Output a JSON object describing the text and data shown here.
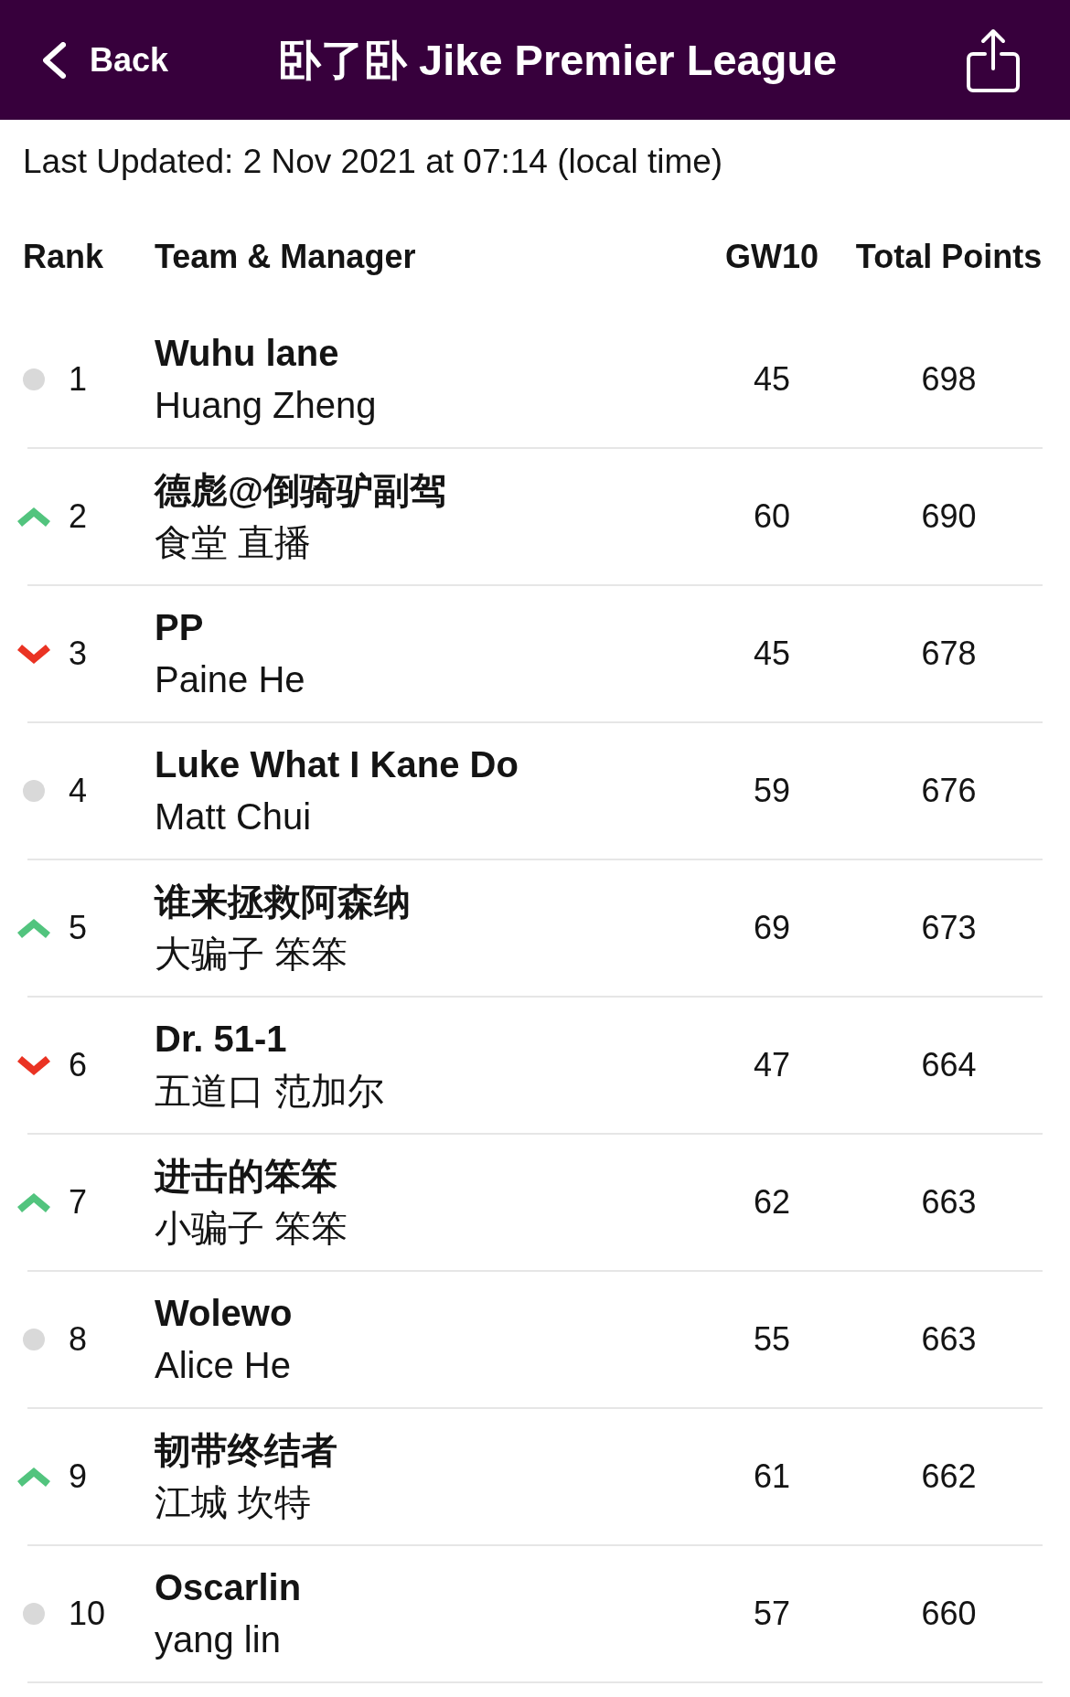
{
  "header": {
    "back_label": "Back",
    "title": "卧了卧 Jike Premier League"
  },
  "last_updated": "Last Updated: 2 Nov 2021 at 07:14 (local time)",
  "table": {
    "columns": [
      "Rank",
      "Team & Manager",
      "GW10",
      "Total Points"
    ],
    "rows": [
      {
        "kind": "same",
        "rank": "1",
        "team": "Wuhu lane",
        "manager": "Huang Zheng",
        "gw": "45",
        "total": "698"
      },
      {
        "kind": "up",
        "rank": "2",
        "team": "德彪@倒骑驴副驾",
        "manager": "食堂 直播",
        "gw": "60",
        "total": "690"
      },
      {
        "kind": "down",
        "rank": "3",
        "team": "PP",
        "manager": "Paine He",
        "gw": "45",
        "total": "678"
      },
      {
        "kind": "same",
        "rank": "4",
        "team": "Luke What I Kane Do",
        "manager": "Matt Chui",
        "gw": "59",
        "total": "676"
      },
      {
        "kind": "up",
        "rank": "5",
        "team": "谁来拯救阿森纳",
        "manager": "大骗子 笨笨",
        "gw": "69",
        "total": "673"
      },
      {
        "kind": "down",
        "rank": "6",
        "team": "Dr. 51-1",
        "manager": "五道口 范加尔",
        "gw": "47",
        "total": "664"
      },
      {
        "kind": "up",
        "rank": "7",
        "team": "进击的笨笨",
        "manager": "小骗子 笨笨",
        "gw": "62",
        "total": "663"
      },
      {
        "kind": "same",
        "rank": "8",
        "team": "Wolewo",
        "manager": "Alice He",
        "gw": "55",
        "total": "663"
      },
      {
        "kind": "up",
        "rank": "9",
        "team": "韧带终结者",
        "manager": "江城 坎特",
        "gw": "61",
        "total": "662"
      },
      {
        "kind": "same",
        "rank": "10",
        "team": "Oscarlin",
        "manager": "yang lin",
        "gw": "57",
        "total": "660"
      }
    ]
  }
}
